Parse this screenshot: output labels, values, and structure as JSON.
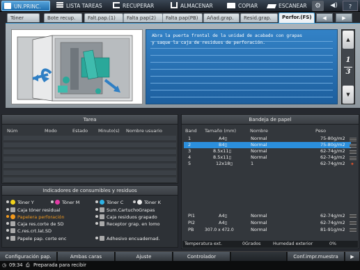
{
  "topbar": {
    "home": "UN.PRINC.",
    "jobs": "LISTA TAREAS",
    "recall": "RECUPERAR",
    "store": "ALMACENAR",
    "copy": "COPIAR",
    "scan": "ESCANEAR",
    "help": "?"
  },
  "tabs": [
    {
      "label": "Tóner"
    },
    {
      "label": "Bote recup."
    },
    {
      "label": "Falt.pap.(1)"
    },
    {
      "label": "Falta pap(2)"
    },
    {
      "label": "Falta pap(PB)"
    },
    {
      "label": "Añad.grap."
    },
    {
      "label": "Resid.grap."
    },
    {
      "label": "Perfor.(FS)"
    }
  ],
  "instruction": {
    "line1": "Abra la puerta frontal de la unidad de acabado con grapas",
    "line2": "y saque la caja de residuos de perforación."
  },
  "pager": {
    "current": "1",
    "total": "3"
  },
  "tarea": {
    "title": "Tarea",
    "columns": [
      "Núm",
      "Modo",
      "Estado",
      "Minuto(s)",
      "Nombre usuario"
    ]
  },
  "consumables": {
    "title": "Indicadores de consumibles y residuos",
    "items": [
      {
        "label": "Tóner Y",
        "color": "#f2d21b"
      },
      {
        "label": "Tóner M",
        "color": "#e23aa6"
      },
      {
        "label": "Tóner C",
        "color": "#2db3e6"
      },
      {
        "label": "Tóner K",
        "color": "#e8e8e8"
      },
      {
        "label": "Caja tóner residual"
      },
      {
        "label": "Sum.CartuchoGrapas"
      },
      {
        "label": "Papelera perforación",
        "color": "#f29a1e"
      },
      {
        "label": "Caja residuos grapado"
      },
      {
        "label": "Caja res.corte de SD"
      },
      {
        "label": "Receptor grap. en lomo"
      },
      {
        "label": "C.res.crt.lat.SD"
      },
      {
        "label": "Papele pap. corte enc"
      },
      {
        "label": "Adhesivo encuadernad."
      }
    ]
  },
  "bandeja": {
    "title": "Bandeja de papel",
    "columns": [
      "Band",
      "Tamaño (mm)",
      "Nombre",
      "Peso"
    ],
    "rows": [
      {
        "band": "1",
        "size": "A4▯",
        "name": "Normal",
        "weight": "75-80g/m2"
      },
      {
        "band": "2",
        "size": "B4▯",
        "name": "Normal",
        "weight": "75-80g/m2"
      },
      {
        "band": "3",
        "size": "8.5x11▯",
        "name": "Normal",
        "weight": "62-74g/m2"
      },
      {
        "band": "4",
        "size": "8.5x11▯",
        "name": "Normal",
        "weight": "62-74g/m2"
      },
      {
        "band": "5",
        "size": "12x18▯",
        "name": "1",
        "weight": "62-74g/m2"
      },
      {
        "band": "PI1",
        "size": "A4▯",
        "name": "Normal",
        "weight": "62-74g/m2"
      },
      {
        "band": "PI2",
        "size": "A4▯",
        "name": "Normal",
        "weight": "62-74g/m2"
      },
      {
        "band": "PB",
        "size": "307.0 x 472.0",
        "name": "Normal",
        "weight": "81-91g/m2"
      }
    ],
    "selected_index": 1,
    "temp_label": "Temperatura ext.",
    "temp_value": "0Grados",
    "humidity_label": "Humedad exterior",
    "humidity_value": "0%"
  },
  "bottom_buttons": [
    {
      "label": "Configuración pap."
    },
    {
      "label": "Ambas caras"
    },
    {
      "label": "Ajuste"
    },
    {
      "label": "Controlador"
    },
    {
      "label": "Conf.impr.muestra"
    }
  ],
  "status": {
    "time": "09:34",
    "message": "Preparada para recibir"
  },
  "colors": {
    "accent": "#2b8fdd",
    "instruction_bg": "#2a72b5"
  }
}
